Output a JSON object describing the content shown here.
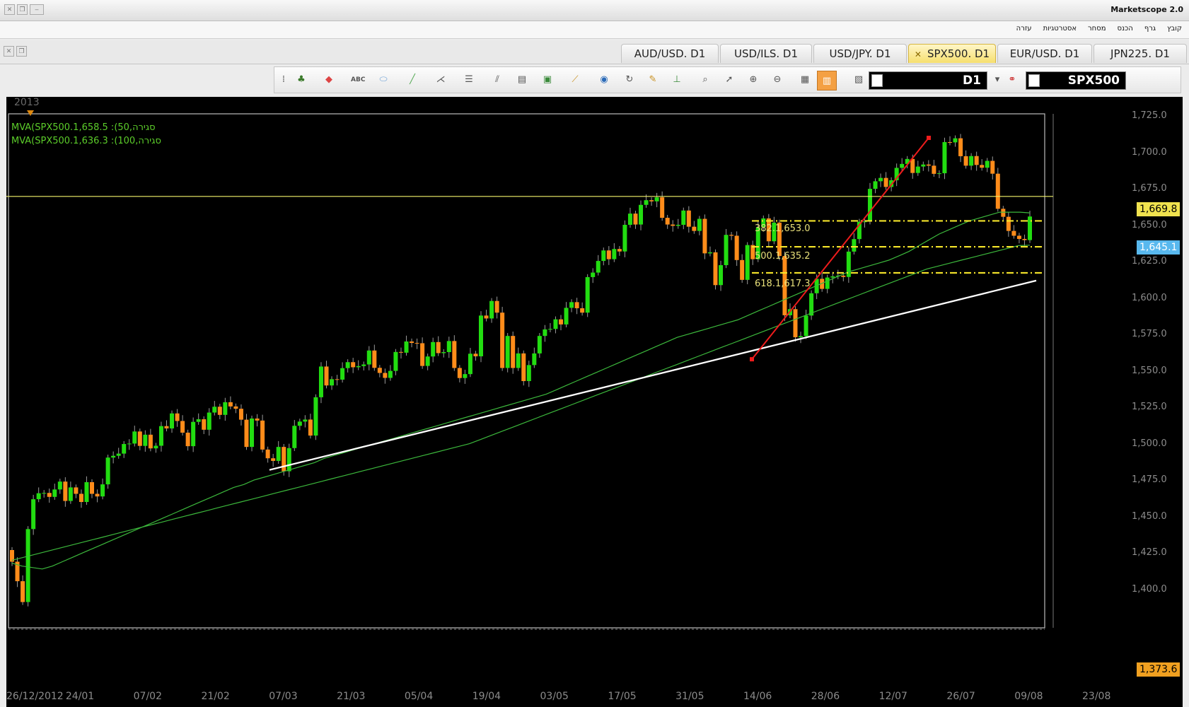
{
  "window": {
    "title": "Marketscope 2.0"
  },
  "menu": [
    "קובץ",
    "גרף",
    "הכנס",
    "מסחר",
    "אסטרטגיות",
    "עזרה"
  ],
  "tabs": [
    {
      "label": "AUD/USD. D1",
      "active": false
    },
    {
      "label": "USD/ILS. D1",
      "active": false
    },
    {
      "label": "USD/JPY. D1",
      "active": false
    },
    {
      "label": "SPX500. D1",
      "active": true
    },
    {
      "label": "EUR/USD. D1",
      "active": false
    },
    {
      "label": "JPN225. D1",
      "active": false
    }
  ],
  "toolbar": {
    "timeframe": "D1",
    "instrument": "SPX500"
  },
  "chart": {
    "year_label": "2013",
    "legend": [
      "MVA(SPX500.1,658.5 :(50,סגירה",
      "MVA(SPX500.1,636.3 :(100,סגירה"
    ],
    "fib_labels": [
      "382.1,653.0",
      "500.1,635.2",
      "618.1,617.3"
    ],
    "price_badges": {
      "resistance": "1,669.8",
      "current": "1,645.1",
      "bottom": "1,373.6"
    },
    "colors": {
      "bull": "#22dd11",
      "bear": "#ff8c1a",
      "ma": "#3cb83c",
      "resistance": "#f3f36a",
      "fib": "#f5e52a",
      "trend": "#ffffff",
      "red": "#ee1c1c"
    }
  },
  "chart_data": {
    "type": "candlestick",
    "title": "",
    "instrument": "SPX500",
    "timeframe": "D1",
    "y_ticks": [
      "1,725.0",
      "1,700.0",
      "1,675.0",
      "1,650.0",
      "1,625.0",
      "1,600.0",
      "1,575.0",
      "1,550.0",
      "1,525.0",
      "1,500.0",
      "1,475.0",
      "1,450.0",
      "1,425.0",
      "1,400.0"
    ],
    "y_tick_values": [
      1725,
      1700,
      1675,
      1650,
      1625,
      1600,
      1575,
      1550,
      1525,
      1500,
      1475,
      1450,
      1425,
      1400
    ],
    "x_ticks": [
      "26/12/2012",
      "24/01",
      "07/02",
      "21/02",
      "07/03",
      "21/03",
      "05/04",
      "19/04",
      "03/05",
      "17/05",
      "31/05",
      "14/06",
      "28/06",
      "12/07",
      "26/07",
      "09/08",
      "23/08"
    ],
    "ylim": [
      1373.6,
      1726.5
    ],
    "closes": [
      1419.0,
      1405.6,
      1391.3,
      1441.4,
      1461.9,
      1466.0,
      1466.2,
      1463.5,
      1468.6,
      1474.0,
      1460.7,
      1470.0,
      1465.6,
      1460.0,
      1473.6,
      1465.6,
      1463.8,
      1472.1,
      1490.5,
      1491.7,
      1493.2,
      1499.8,
      1500.1,
      1508.4,
      1498.5,
      1506.2,
      1496.8,
      1498.6,
      1512.1,
      1510.5,
      1520.8,
      1515.6,
      1507.6,
      1498.3,
      1515.0,
      1516.8,
      1509.6,
      1521.4,
      1525.4,
      1519.8,
      1528.5,
      1525.6,
      1524.0,
      1516.5,
      1497.8,
      1517.3,
      1515.9,
      1496.0,
      1490.0,
      1488.2,
      1497.8,
      1481.1,
      1497.0,
      1512.3,
      1515.2,
      1516.6,
      1505.6,
      1531.9,
      1553.0,
      1540.0,
      1544.3,
      1544.0,
      1551.9,
      1556.0,
      1552.5,
      1553.3,
      1554.4,
      1564.0,
      1552.1,
      1548.6,
      1545.2,
      1550.0,
      1563.0,
      1562.5,
      1570.2,
      1569.2,
      1569.0,
      1553.4,
      1559.9,
      1569.8,
      1562.2,
      1562.9,
      1570.5,
      1552.0,
      1545.1,
      1547.8,
      1561.8,
      1560.0,
      1588.0,
      1586.0,
      1598.0,
      1590.0,
      1552.0,
      1574.0,
      1552.0,
      1562.0,
      1543.0,
      1554.0,
      1562.0,
      1574.0,
      1578.5,
      1578.8,
      1585.4,
      1581.9,
      1593.3,
      1597.2,
      1593.0,
      1590.0,
      1614.4,
      1617.5,
      1625.5,
      1632.7,
      1626.7,
      1633.7,
      1632.0,
      1650.3,
      1658.0,
      1650.5,
      1664.0,
      1667.2,
      1666.4,
      1669.2,
      1655.1,
      1650.5,
      1649.6,
      1650.3,
      1660.1,
      1649.0,
      1646.1,
      1654.4,
      1630.7,
      1631.4,
      1608.9,
      1622.6,
      1643.4,
      1642.8,
      1626.1,
      1612.5,
      1636.4,
      1626.7,
      1648.6,
      1654.7,
      1639.0,
      1651.8,
      1628.9,
      1588.2,
      1592.4,
      1573.1,
      1573.9,
      1588.0,
      1603.3,
      1613.2,
      1606.3,
      1614.1,
      1614.9,
      1615.4,
      1614.5,
      1631.9,
      1640.5,
      1652.4,
      1652.6,
      1675.0,
      1680.2,
      1682.5,
      1676.3,
      1680.9,
      1689.4,
      1692.1,
      1695.5,
      1685.9,
      1690.3,
      1691.7,
      1690.9,
      1685.3,
      1685.7,
      1707.1,
      1706.9,
      1709.7,
      1697.4,
      1690.9,
      1697.5,
      1691.4,
      1689.5,
      1694.2,
      1685.4,
      1661.3,
      1655.8,
      1646.1,
      1642.8,
      1640.6,
      1639.8,
      1656.0
    ],
    "ma50": [
      1418,
      1416,
      1415,
      1414,
      1416,
      1419,
      1422,
      1425,
      1428,
      1431,
      1434,
      1437,
      1440,
      1443,
      1446,
      1449,
      1452,
      1455,
      1458,
      1461,
      1464,
      1467,
      1470,
      1472,
      1475,
      1477,
      1479,
      1481,
      1483,
      1485,
      1487,
      1490,
      1492,
      1494,
      1496,
      1498,
      1500,
      1502,
      1504,
      1506,
      1508,
      1510,
      1512,
      1514,
      1516,
      1518,
      1520,
      1522,
      1524,
      1526,
      1528,
      1530,
      1532,
      1534,
      1537,
      1540,
      1543,
      1546,
      1549,
      1552,
      1555,
      1558,
      1561,
      1564,
      1567,
      1570,
      1573,
      1575,
      1577,
      1579,
      1581,
      1583,
      1585,
      1588,
      1591,
      1594,
      1597,
      1600,
      1603,
      1606,
      1609,
      1612,
      1615,
      1618,
      1620,
      1622,
      1624,
      1626,
      1629,
      1632,
      1636,
      1640,
      1644,
      1647,
      1650,
      1653,
      1655,
      1657,
      1659,
      1659,
      1659,
      1658.5
    ],
    "ma100": [
      1420,
      1422,
      1424,
      1426,
      1428,
      1430,
      1432,
      1434,
      1436,
      1438,
      1440,
      1442,
      1444,
      1446,
      1448,
      1450,
      1452,
      1454,
      1456,
      1458,
      1460,
      1462,
      1464,
      1466,
      1468,
      1470,
      1472,
      1474,
      1476,
      1478,
      1480,
      1482,
      1484,
      1486,
      1488,
      1490,
      1492,
      1494,
      1496,
      1498,
      1500,
      1503,
      1506,
      1509,
      1512,
      1515,
      1518,
      1521,
      1524,
      1527,
      1530,
      1533,
      1536,
      1539,
      1542,
      1545,
      1548,
      1551,
      1554,
      1557,
      1560,
      1563,
      1566,
      1569,
      1572,
      1575,
      1578,
      1581,
      1584,
      1587,
      1590,
      1593,
      1596,
      1599,
      1602,
      1605,
      1608,
      1611,
      1614,
      1617,
      1620,
      1622,
      1624,
      1626,
      1628,
      1630,
      1632,
      1634,
      1636,
      1636.3
    ],
    "resistance": 1669.8,
    "fib_levels": [
      {
        "label": "382.1,653.0",
        "value": 1653.0
      },
      {
        "label": "500.1,635.2",
        "value": 1635.2
      },
      {
        "label": "618.1,617.3",
        "value": 1617.3
      }
    ],
    "current_price": 1645.1
  }
}
